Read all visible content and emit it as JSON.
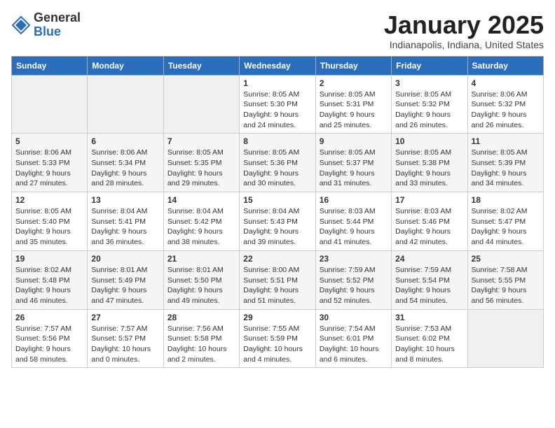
{
  "header": {
    "logo_general": "General",
    "logo_blue": "Blue",
    "month_title": "January 2025",
    "location": "Indianapolis, Indiana, United States"
  },
  "days_of_week": [
    "Sunday",
    "Monday",
    "Tuesday",
    "Wednesday",
    "Thursday",
    "Friday",
    "Saturday"
  ],
  "weeks": [
    [
      {
        "day": "",
        "info": ""
      },
      {
        "day": "",
        "info": ""
      },
      {
        "day": "",
        "info": ""
      },
      {
        "day": "1",
        "info": "Sunrise: 8:05 AM\nSunset: 5:30 PM\nDaylight: 9 hours and 24 minutes."
      },
      {
        "day": "2",
        "info": "Sunrise: 8:05 AM\nSunset: 5:31 PM\nDaylight: 9 hours and 25 minutes."
      },
      {
        "day": "3",
        "info": "Sunrise: 8:05 AM\nSunset: 5:32 PM\nDaylight: 9 hours and 26 minutes."
      },
      {
        "day": "4",
        "info": "Sunrise: 8:06 AM\nSunset: 5:32 PM\nDaylight: 9 hours and 26 minutes."
      }
    ],
    [
      {
        "day": "5",
        "info": "Sunrise: 8:06 AM\nSunset: 5:33 PM\nDaylight: 9 hours and 27 minutes."
      },
      {
        "day": "6",
        "info": "Sunrise: 8:06 AM\nSunset: 5:34 PM\nDaylight: 9 hours and 28 minutes."
      },
      {
        "day": "7",
        "info": "Sunrise: 8:05 AM\nSunset: 5:35 PM\nDaylight: 9 hours and 29 minutes."
      },
      {
        "day": "8",
        "info": "Sunrise: 8:05 AM\nSunset: 5:36 PM\nDaylight: 9 hours and 30 minutes."
      },
      {
        "day": "9",
        "info": "Sunrise: 8:05 AM\nSunset: 5:37 PM\nDaylight: 9 hours and 31 minutes."
      },
      {
        "day": "10",
        "info": "Sunrise: 8:05 AM\nSunset: 5:38 PM\nDaylight: 9 hours and 33 minutes."
      },
      {
        "day": "11",
        "info": "Sunrise: 8:05 AM\nSunset: 5:39 PM\nDaylight: 9 hours and 34 minutes."
      }
    ],
    [
      {
        "day": "12",
        "info": "Sunrise: 8:05 AM\nSunset: 5:40 PM\nDaylight: 9 hours and 35 minutes."
      },
      {
        "day": "13",
        "info": "Sunrise: 8:04 AM\nSunset: 5:41 PM\nDaylight: 9 hours and 36 minutes."
      },
      {
        "day": "14",
        "info": "Sunrise: 8:04 AM\nSunset: 5:42 PM\nDaylight: 9 hours and 38 minutes."
      },
      {
        "day": "15",
        "info": "Sunrise: 8:04 AM\nSunset: 5:43 PM\nDaylight: 9 hours and 39 minutes."
      },
      {
        "day": "16",
        "info": "Sunrise: 8:03 AM\nSunset: 5:44 PM\nDaylight: 9 hours and 41 minutes."
      },
      {
        "day": "17",
        "info": "Sunrise: 8:03 AM\nSunset: 5:46 PM\nDaylight: 9 hours and 42 minutes."
      },
      {
        "day": "18",
        "info": "Sunrise: 8:02 AM\nSunset: 5:47 PM\nDaylight: 9 hours and 44 minutes."
      }
    ],
    [
      {
        "day": "19",
        "info": "Sunrise: 8:02 AM\nSunset: 5:48 PM\nDaylight: 9 hours and 46 minutes."
      },
      {
        "day": "20",
        "info": "Sunrise: 8:01 AM\nSunset: 5:49 PM\nDaylight: 9 hours and 47 minutes."
      },
      {
        "day": "21",
        "info": "Sunrise: 8:01 AM\nSunset: 5:50 PM\nDaylight: 9 hours and 49 minutes."
      },
      {
        "day": "22",
        "info": "Sunrise: 8:00 AM\nSunset: 5:51 PM\nDaylight: 9 hours and 51 minutes."
      },
      {
        "day": "23",
        "info": "Sunrise: 7:59 AM\nSunset: 5:52 PM\nDaylight: 9 hours and 52 minutes."
      },
      {
        "day": "24",
        "info": "Sunrise: 7:59 AM\nSunset: 5:54 PM\nDaylight: 9 hours and 54 minutes."
      },
      {
        "day": "25",
        "info": "Sunrise: 7:58 AM\nSunset: 5:55 PM\nDaylight: 9 hours and 56 minutes."
      }
    ],
    [
      {
        "day": "26",
        "info": "Sunrise: 7:57 AM\nSunset: 5:56 PM\nDaylight: 9 hours and 58 minutes."
      },
      {
        "day": "27",
        "info": "Sunrise: 7:57 AM\nSunset: 5:57 PM\nDaylight: 10 hours and 0 minutes."
      },
      {
        "day": "28",
        "info": "Sunrise: 7:56 AM\nSunset: 5:58 PM\nDaylight: 10 hours and 2 minutes."
      },
      {
        "day": "29",
        "info": "Sunrise: 7:55 AM\nSunset: 5:59 PM\nDaylight: 10 hours and 4 minutes."
      },
      {
        "day": "30",
        "info": "Sunrise: 7:54 AM\nSunset: 6:01 PM\nDaylight: 10 hours and 6 minutes."
      },
      {
        "day": "31",
        "info": "Sunrise: 7:53 AM\nSunset: 6:02 PM\nDaylight: 10 hours and 8 minutes."
      },
      {
        "day": "",
        "info": ""
      }
    ]
  ]
}
